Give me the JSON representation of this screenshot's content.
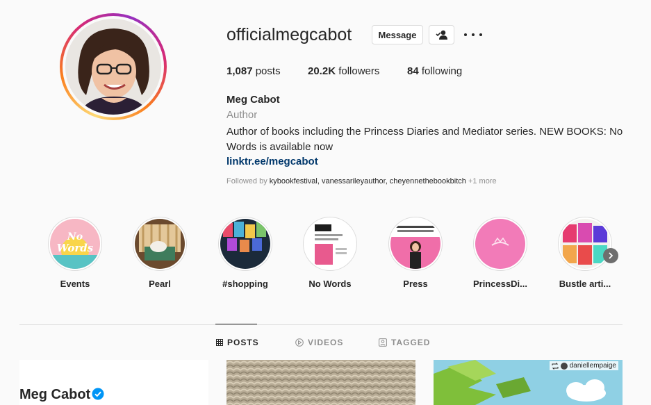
{
  "profile": {
    "username": "officialmegcabot",
    "message_label": "Message",
    "stats": {
      "posts_count": "1,087",
      "posts_label": "posts",
      "followers_count": "20.2K",
      "followers_label": "followers",
      "following_count": "84",
      "following_label": "following"
    },
    "full_name": "Meg Cabot",
    "category": "Author",
    "bio": "Author of books including the Princess Diaries and Mediator series. NEW BOOKS: No Words is available now",
    "link": "linktr.ee/megcabot",
    "followed_by_prefix": "Followed by",
    "followed_by_names": "kybookfestival, vanessarileyauthor, cheyennethebookbitch",
    "followed_by_more": "+1 more"
  },
  "highlights": [
    {
      "label": "Events",
      "icon": "no-words-cover"
    },
    {
      "label": "Pearl",
      "icon": "dog-on-chair"
    },
    {
      "label": "#shopping",
      "icon": "shop-online"
    },
    {
      "label": "No Words",
      "icon": "book-cover"
    },
    {
      "label": "Press",
      "icon": "press-article"
    },
    {
      "label": "PrincessDi...",
      "icon": "princess-pink"
    },
    {
      "label": "Bustle arti...",
      "icon": "bustle-collage"
    }
  ],
  "tabs": [
    {
      "label": "POSTS",
      "icon": "grid-icon",
      "active": true
    },
    {
      "label": "VIDEOS",
      "icon": "play-icon",
      "active": false
    },
    {
      "label": "TAGGED",
      "icon": "tag-icon",
      "active": false
    }
  ],
  "posts": {
    "post1_title": "Meg Cabot",
    "post3_repost_user": "daniellempaige"
  },
  "colors": {
    "link": "#00376b",
    "verified": "#0095f6",
    "text": "#262626",
    "secondary": "#8e8e8e"
  }
}
